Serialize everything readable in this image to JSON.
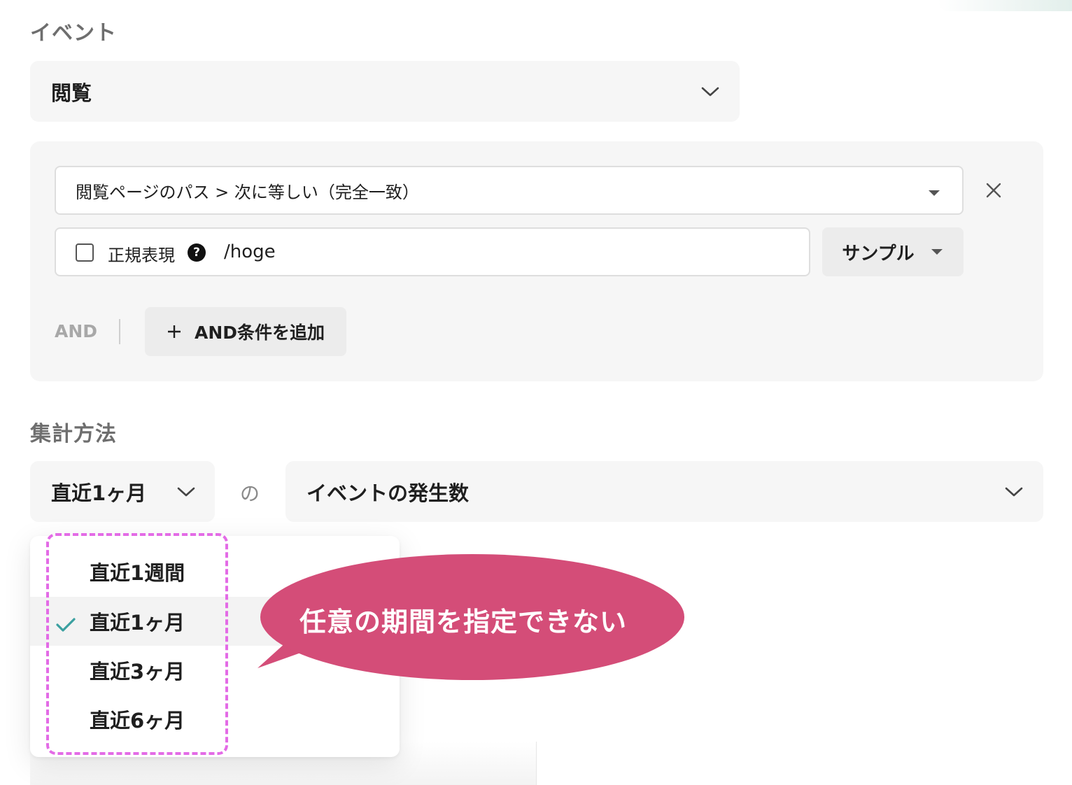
{
  "event_section": {
    "label": "イベント",
    "event_select": {
      "value": "閲覧"
    },
    "condition": {
      "property_select": {
        "value": "閲覧ページのパス > 次に等しい（完全一致）"
      },
      "regex_label": "正規表現",
      "help_glyph": "?",
      "value_input": {
        "value": "/hoge"
      },
      "sample_button": "サンプル"
    },
    "and_label": "AND",
    "add_and_button": {
      "icon": "plus-icon",
      "label": "AND条件を追加"
    }
  },
  "aggregation_section": {
    "label": "集計方法",
    "period_select": {
      "value": "直近1ヶ月"
    },
    "connector": "の",
    "metric_select": {
      "value": "イベントの発生数"
    },
    "period_options": [
      {
        "label": "直近1週間",
        "selected": false
      },
      {
        "label": "直近1ヶ月",
        "selected": true
      },
      {
        "label": "直近3ヶ月",
        "selected": false
      },
      {
        "label": "直近6ヶ月",
        "selected": false
      }
    ]
  },
  "callout": {
    "text": "任意の期間を指定できない",
    "color": "#d44d78"
  },
  "colors": {
    "highlight_dash": "#e36be6",
    "check": "#3aa0a0"
  }
}
